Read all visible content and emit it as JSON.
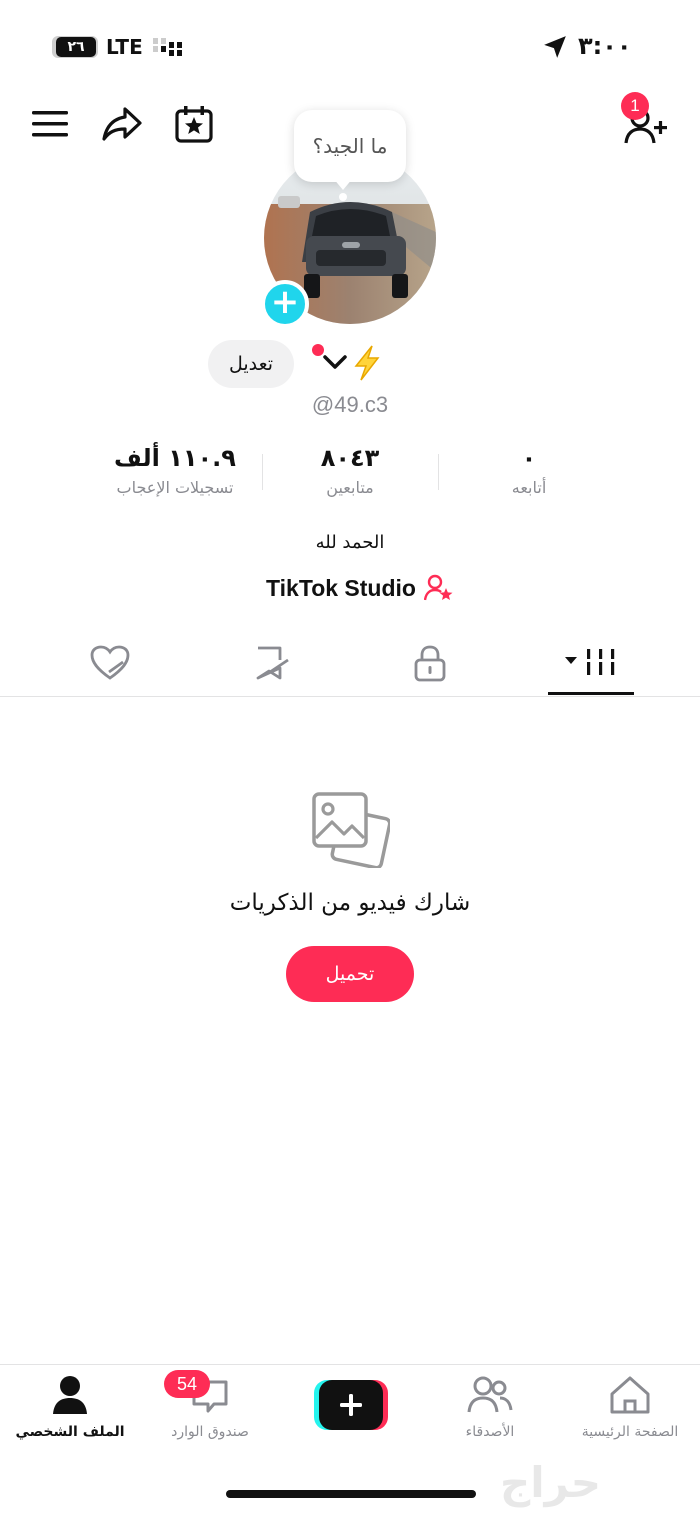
{
  "status_bar": {
    "battery": "٢٦",
    "network": "LTE",
    "time": "٣:٠٠"
  },
  "header": {
    "follow_requests_badge": "1"
  },
  "profile": {
    "bubble_text": "ما الجيد؟",
    "edit_label": "تعديل",
    "username": "@49.c3",
    "bio": "الحمد لله",
    "studio_link": "TikTok Studio"
  },
  "stats": [
    {
      "value": "١١٠.٩ ألف",
      "label": "تسجيلات الإعجاب"
    },
    {
      "value": "٨٠٤٣",
      "label": "متابعين"
    },
    {
      "value": "٠",
      "label": "أتابعه"
    }
  ],
  "empty_state": {
    "title": "شارك فيديو من الذكريات",
    "button": "تحميل"
  },
  "bottom_nav": {
    "profile": "الملف الشخصي",
    "inbox": "صندوق الوارد",
    "inbox_badge": "54",
    "friends": "الأصدقاء",
    "home": "الصفحة الرئيسية"
  },
  "watermark": "حراج",
  "colors": {
    "accent": "#fe2c55",
    "cyan": "#20d5ec",
    "muted": "#8a8b91"
  }
}
